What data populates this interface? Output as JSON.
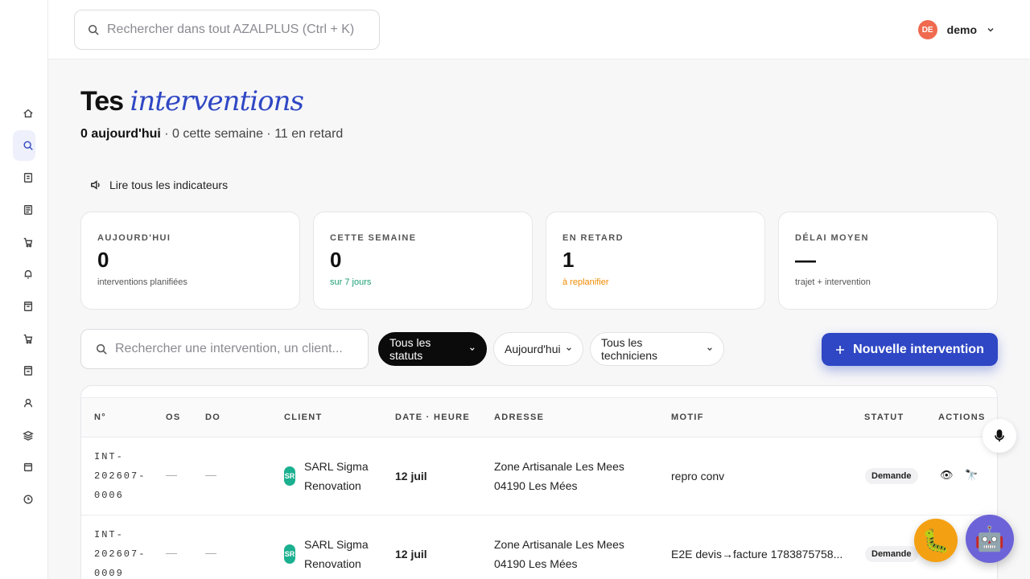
{
  "search": {
    "placeholder": "Rechercher dans tout AZALPLUS (Ctrl + K)"
  },
  "user": {
    "initials": "DE",
    "name": "demo"
  },
  "sidebar": {
    "items": [
      {
        "icon": "home-icon"
      },
      {
        "icon": "search-icon",
        "active": true
      },
      {
        "icon": "document-icon"
      },
      {
        "icon": "list-icon"
      },
      {
        "icon": "cart-icon"
      },
      {
        "icon": "bell-icon"
      },
      {
        "icon": "file-icon"
      },
      {
        "icon": "cart-icon"
      },
      {
        "icon": "file-icon"
      },
      {
        "icon": "user-icon"
      },
      {
        "icon": "layers-icon"
      },
      {
        "icon": "folder-icon"
      },
      {
        "icon": "clock-icon"
      }
    ]
  },
  "header": {
    "title_plain": "Tes",
    "title_accent": "interventions",
    "summary_today": "0 aujourd'hui",
    "summary_rest": " · 0 cette semaine · 11 en retard"
  },
  "read_all_label": "Lire tous les indicateurs",
  "kpis": [
    {
      "label": "AUJOURD'HUI",
      "value": "0",
      "sub": "interventions planifiées",
      "sub_color": "#555555"
    },
    {
      "label": "CETTE SEMAINE",
      "value": "0",
      "sub": "sur 7 jours",
      "sub_color": "#1a9e74"
    },
    {
      "label": "EN RETARD",
      "value": "1",
      "sub": "à replanifier",
      "sub_color": "#f08a00"
    },
    {
      "label": "DÉLAI MOYEN",
      "value": "—",
      "sub": "trajet + intervention",
      "sub_color": "#555555"
    }
  ],
  "filters": {
    "search_placeholder": "Rechercher une intervention, un client...",
    "status": "Tous les statuts",
    "period": "Aujourd'hui",
    "technicians": "Tous les techniciens",
    "new_button": "Nouvelle intervention"
  },
  "table": {
    "headers": [
      "N°",
      "OS",
      "DO",
      "CLIENT",
      "DATE · HEURE",
      "ADRESSE",
      "MOTIF",
      "STATUT",
      "ACTIONS"
    ],
    "rows": [
      {
        "num": [
          "INT-",
          "202607-",
          "0006"
        ],
        "os": "—",
        "do": "—",
        "client_initials": "SR",
        "client": [
          "SARL Sigma",
          "Renovation"
        ],
        "date": "12 juil",
        "address": [
          "Zone Artisanale Les Mees",
          "04190 Les Mées"
        ],
        "motif": "repro conv",
        "status": "Demande"
      },
      {
        "num": [
          "INT-",
          "202607-",
          "0009"
        ],
        "os": "—",
        "do": "—",
        "client_initials": "SR",
        "client": [
          "SARL Sigma",
          "Renovation"
        ],
        "date": "12 juil",
        "address": [
          "Zone Artisanale Les Mees",
          "04190 Les Mées"
        ],
        "motif": "E2E devis→facture 1783875758...",
        "status": "Demande"
      }
    ]
  },
  "colors": {
    "accent": "#2f47c4",
    "avatar": "#ef6a4f",
    "client_badge": "#1bb08f",
    "bug_fab": "#f4a013",
    "bot_fab": "#6d63d8"
  }
}
